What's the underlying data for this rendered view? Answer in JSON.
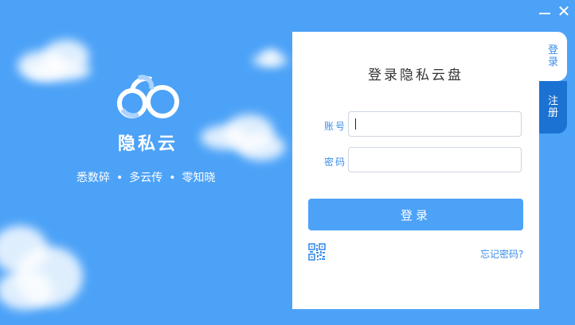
{
  "window": {
    "minimize_icon": "minimize-icon",
    "close_icon": "close-icon",
    "close_glyph": "✕"
  },
  "brand": {
    "logo_icon": "cloud-logo-icon",
    "name": "隐私云",
    "tagline": [
      "悉数碎",
      "多云传",
      "零知晓"
    ],
    "tagline_separator": "•"
  },
  "tabs": {
    "login": "登录",
    "register": "注册"
  },
  "login": {
    "title": "登录隐私云盘",
    "account_label": "账号",
    "account_value": "",
    "password_label": "密码",
    "password_value": "",
    "submit_label": "登录",
    "qr_icon": "qr-code-icon",
    "forgot_password": "忘记密码?"
  },
  "colors": {
    "background": "#4ca2f7",
    "accent": "#3a8de8",
    "button": "#4ca2f7",
    "register_tab": "#1b72d2",
    "panel": "#ffffff"
  }
}
